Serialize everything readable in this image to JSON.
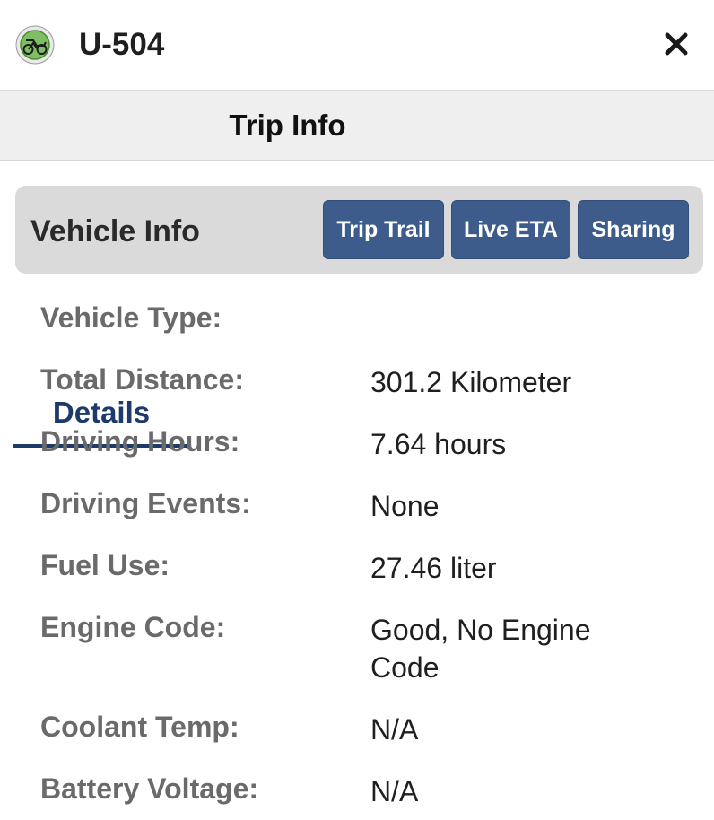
{
  "header": {
    "vehicle_id": "U-504",
    "vehicle_icon": "vehicle-status-icon",
    "close_icon": "close-icon",
    "accent_color": "#1c3a6a"
  },
  "tabs": [
    {
      "label": "Details",
      "active": true
    },
    {
      "label": "Trip Info",
      "active": false
    }
  ],
  "vehicle_info": {
    "title": "Vehicle Info",
    "buttons": {
      "trip_trail": "Trip Trail",
      "live_eta": "Live ETA",
      "sharing": "Sharing"
    },
    "button_color": "#3d5c8b"
  },
  "details": [
    {
      "label": "Vehicle Type:",
      "value": ""
    },
    {
      "label": "Total Distance:",
      "value": "301.2 Kilometer"
    },
    {
      "label": "Driving Hours:",
      "value": "7.64 hours"
    },
    {
      "label": "Driving Events:",
      "value": "None"
    },
    {
      "label": "Fuel Use:",
      "value": "27.46 liter"
    },
    {
      "label": "Engine Code:",
      "value": "Good, No Engine Code"
    },
    {
      "label": "Coolant Temp:",
      "value": "N/A"
    },
    {
      "label": "Battery Voltage:",
      "value": "N/A"
    }
  ]
}
